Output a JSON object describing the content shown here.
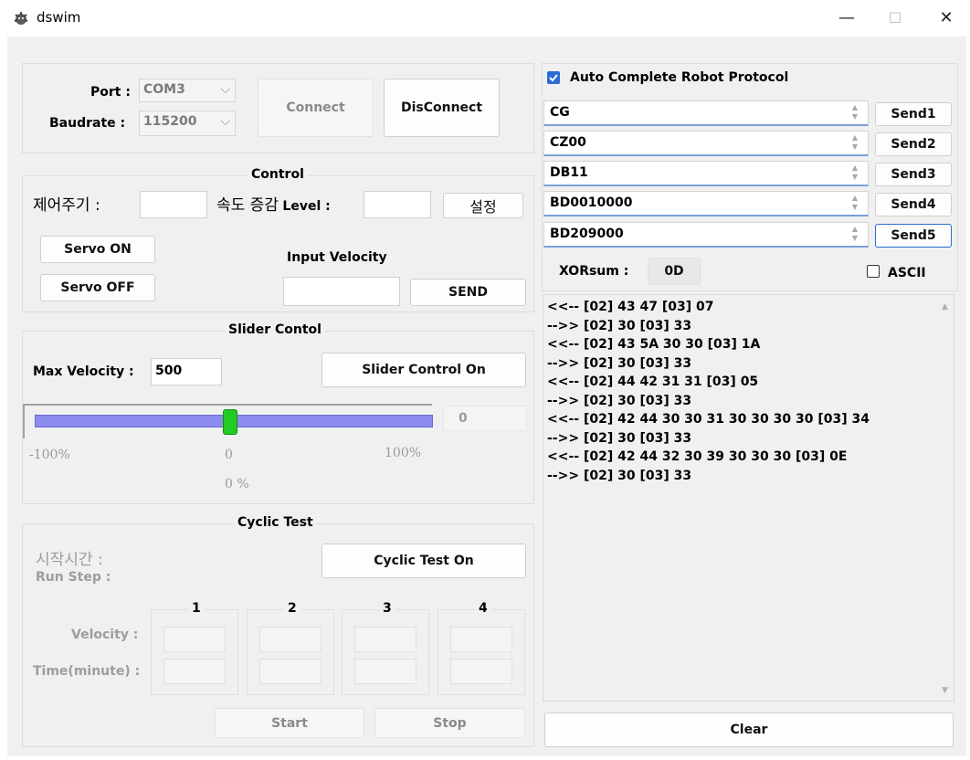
{
  "window": {
    "title": "dswim",
    "minimize": "—",
    "maximize": "☐",
    "close": "✕"
  },
  "connection": {
    "port_label": "Port :",
    "port_value": "COM3",
    "baudrate_label": "Baudrate :",
    "baudrate_value": "115200",
    "connect_label": "Connect",
    "disconnect_label": "DisConnect"
  },
  "control": {
    "legend": "Control",
    "period_label": "제어주기 :",
    "speed_label_kor": "속도 증감",
    "speed_label_eng": "Level :",
    "set_button": "설정",
    "servo_on": "Servo ON",
    "servo_off": "Servo OFF",
    "input_velocity_label": "Input Velocity",
    "send_button": "SEND"
  },
  "slider": {
    "legend": "Slider Contol",
    "max_velocity_label": "Max Velocity :",
    "max_velocity_value": "500",
    "slider_control_button": "Slider Control On",
    "readout": "0",
    "min_label": "-100%",
    "mid_label": "0",
    "max_label": "100%",
    "percent_label": "0 %",
    "position_percent": 0
  },
  "cyclic": {
    "legend": "Cyclic Test",
    "start_time_label": "시작시간 :",
    "run_step_label": "Run Step :",
    "cyclic_button": "Cyclic Test On",
    "steps": [
      "1",
      "2",
      "3",
      "4"
    ],
    "velocity_label": "Velocity :",
    "time_label": "Time(minute) :",
    "start_button": "Start",
    "stop_button": "Stop"
  },
  "protocol": {
    "auto_complete_label": "Auto Complete Robot Protocol",
    "auto_complete_checked": true,
    "rows": [
      {
        "value": "CG",
        "button": "Send1"
      },
      {
        "value": "CZ00",
        "button": "Send2"
      },
      {
        "value": "DB11",
        "button": "Send3"
      },
      {
        "value": "BD0010000",
        "button": "Send4"
      },
      {
        "value": "BD209000",
        "button": "Send5"
      }
    ],
    "xorsum_label": "XORsum :",
    "xorsum_value": "0D",
    "ascii_label": "ASCII",
    "ascii_checked": false
  },
  "log": {
    "lines": [
      "<<-- [02] 43 47 [03] 07",
      "-->> [02] 30 [03] 33",
      "<<-- [02] 43 5A 30 30 [03] 1A",
      "-->> [02] 30 [03] 33",
      "<<-- [02] 44 42 31 31 [03] 05",
      "-->> [02] 30 [03] 33",
      "<<-- [02] 42 44 30 30 31 30 30 30 30 [03] 34",
      "-->> [02] 30 [03] 33",
      "<<-- [02] 42 44 32 30 39 30 30 30 [03] 0E",
      "-->> [02] 30 [03] 33"
    ],
    "clear_button": "Clear"
  },
  "colors": {
    "accent": "#2b6cd4",
    "slider_track": "#8c8cee",
    "slider_thumb": "#22cc22"
  }
}
